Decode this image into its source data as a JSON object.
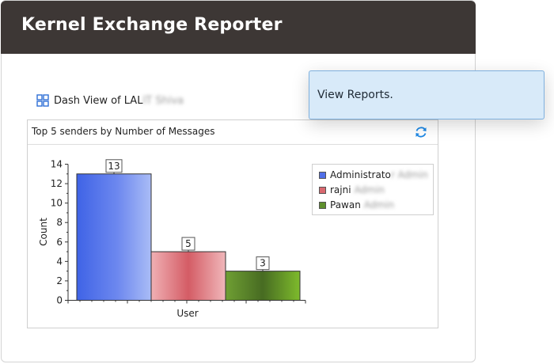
{
  "app": {
    "title": "Kernel Exchange Reporter"
  },
  "dashboard": {
    "view_label": "Dash View of LAL",
    "view_label_blurred": "IT Shiva",
    "icon": "grid-icon"
  },
  "panel": {
    "title": "Top 5 senders by Number of Messages",
    "refresh_icon": "refresh-icon"
  },
  "tooltip": {
    "text": "View Reports."
  },
  "colors": {
    "titlebar": "#3d3735",
    "tooltip_bg": "#d8eaf9",
    "accent": "#1e88e5"
  },
  "chart_data": {
    "type": "bar",
    "categories": [
      "Administrator",
      "rajni",
      "Pawan"
    ],
    "values": [
      13,
      5,
      3
    ],
    "data_labels": [
      "13",
      "5",
      "3"
    ],
    "ylabel": "Count",
    "xlabel": "User",
    "ylim": [
      0,
      14
    ],
    "yticks": [
      "0",
      "2",
      "4",
      "6",
      "8",
      "10",
      "12",
      "14"
    ],
    "colors": [
      "#4f6fe8",
      "#d9686f",
      "#5e8f2c"
    ],
    "legend": {
      "placement": "right",
      "entries": [
        {
          "name": "Administrato",
          "blurred": "r Admin",
          "color": "#4f6fe8"
        },
        {
          "name": "rajni",
          "blurred": "Admin",
          "color": "#d9686f"
        },
        {
          "name": "Pawan",
          "blurred": "Admin",
          "color": "#5e8f2c"
        }
      ]
    }
  }
}
